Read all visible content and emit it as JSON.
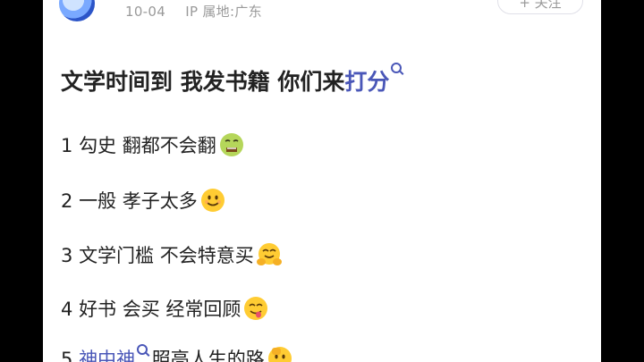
{
  "post": {
    "date": "10-04",
    "location": "IP 属地:广东",
    "follow_label": "+ 关注"
  },
  "title": {
    "main": "文学时间到 我发书籍 你们来",
    "highlight": "打分"
  },
  "items": [
    {
      "number": "1",
      "text": "勾史 翻都不会翻",
      "emoji": "nauseated-face-icon"
    },
    {
      "number": "2",
      "text": "一般 孝子太多",
      "emoji": "smiling-face-icon"
    },
    {
      "number": "3",
      "text": "文学门槛 不会特意买",
      "emoji": "hugging-face-icon"
    },
    {
      "number": "4",
      "text": "好书 会买 经常回顾",
      "emoji": "face-savoring-food-icon"
    },
    {
      "number": "5",
      "highlight": "神中神",
      "text": "照亮人生的路",
      "emoji": "face-with-hand-icon"
    }
  ],
  "colors": {
    "link": "#4a57b8",
    "meta": "#9a9a9a",
    "text": "#222222"
  }
}
